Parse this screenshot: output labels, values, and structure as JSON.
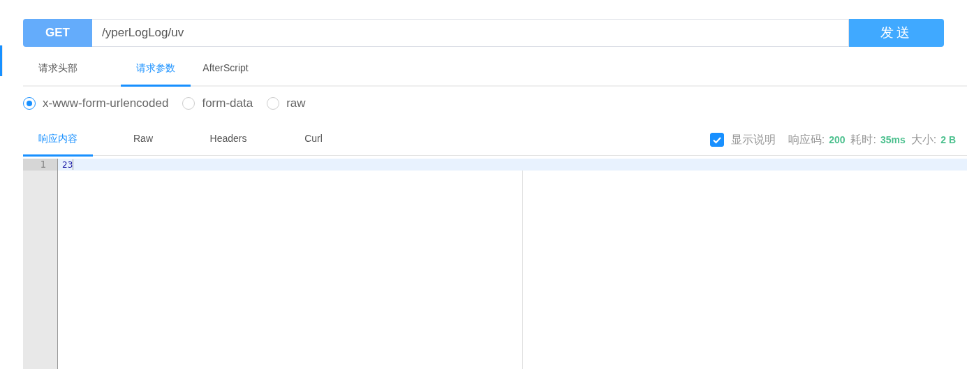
{
  "request": {
    "method": "GET",
    "url": "/yperLogLog/uv",
    "send_label": "发送"
  },
  "request_tabs": [
    {
      "label": "请求头部",
      "selected": false
    },
    {
      "label": "请求参数",
      "selected": true
    },
    {
      "label": "AfterScript",
      "selected": false
    }
  ],
  "body_types": [
    {
      "label": "x-www-form-urlencoded",
      "selected": true
    },
    {
      "label": "form-data",
      "selected": false
    },
    {
      "label": "raw",
      "selected": false
    }
  ],
  "response_tabs": [
    {
      "label": "响应内容",
      "selected": true
    },
    {
      "label": "Raw",
      "selected": false
    },
    {
      "label": "Headers",
      "selected": false
    },
    {
      "label": "Curl",
      "selected": false
    }
  ],
  "show_description": {
    "label": "显示说明",
    "checked": true
  },
  "stats": [
    {
      "label": "响应码:",
      "value": "200"
    },
    {
      "label": "耗时:",
      "value": "35ms"
    },
    {
      "label": "大小:",
      "value": "2 B"
    }
  ],
  "editor": {
    "lines": [
      {
        "number": "1",
        "text": "23",
        "active": true
      }
    ]
  }
}
